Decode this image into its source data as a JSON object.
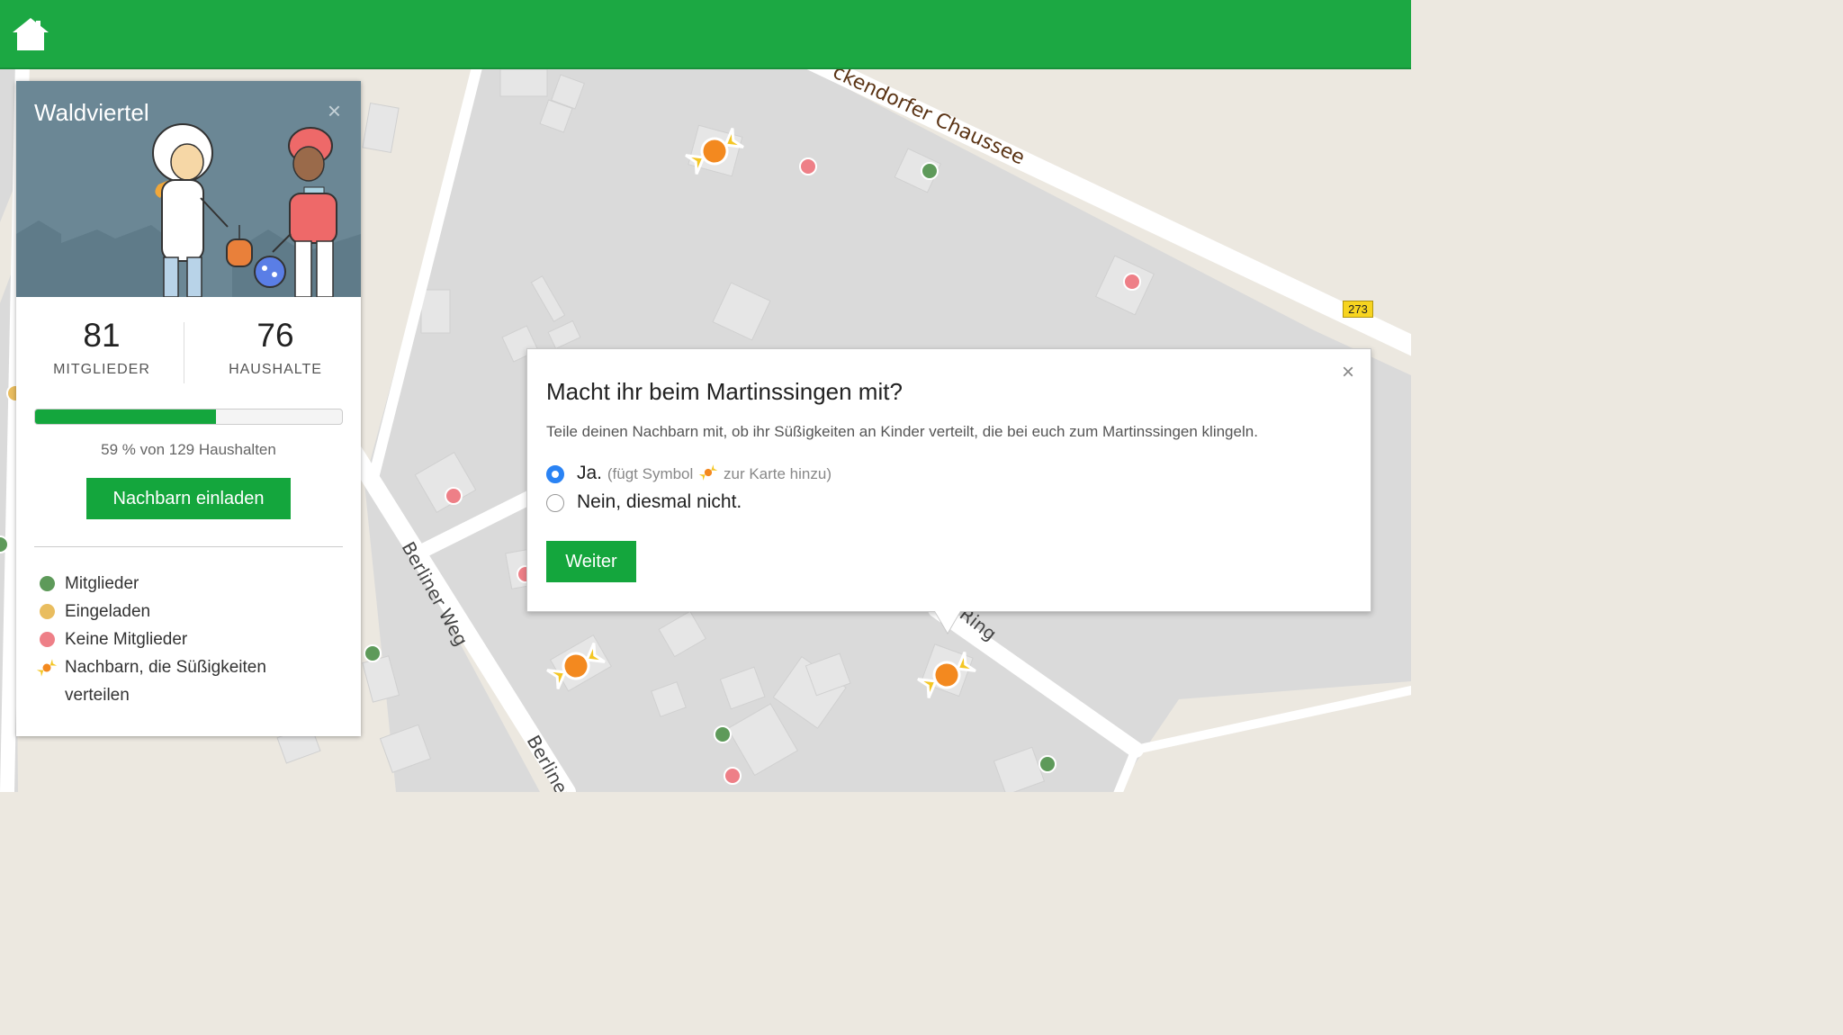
{
  "header": {
    "home_icon": "home-icon",
    "color": "#1ca843"
  },
  "map": {
    "streets": {
      "chaussee": "ckendorfer Chaussee",
      "berliner_weg": "Berliner Weg",
      "berliner_lower": "Berliner",
      "ring": "Ring"
    },
    "route_badge": "273"
  },
  "panel": {
    "title": "Waldviertel",
    "close_label": "×",
    "stats": [
      {
        "value": "81",
        "label": "MITGLIEDER"
      },
      {
        "value": "76",
        "label": "HAUSHALTE"
      }
    ],
    "progress": {
      "fraction": 0.59,
      "text": "59 % von 129 Haushalten"
    },
    "invite_button": "Nachbarn einladen",
    "legend": [
      {
        "label": "Mitglieder",
        "color": "#5e9a5a"
      },
      {
        "label": "Eingeladen",
        "color": "#e9bd5f"
      },
      {
        "label": "Keine Mitglieder",
        "color": "#ee7f87"
      },
      {
        "label": "Nachbarn, die Süßigkeiten",
        "label2": "verteilen",
        "icon": "candy-icon"
      }
    ]
  },
  "dialog": {
    "title": "Macht ihr beim Martinssingen mit?",
    "description": "Teile deinen Nachbarn mit, ob ihr Süßigkeiten an Kinder verteilt, die bei euch zum Martinssingen klingeln.",
    "close_label": "×",
    "options": [
      {
        "label": "Ja.",
        "hint_pre": "(fügt Symbol",
        "hint_post": "zur Karte hinzu)",
        "selected": true
      },
      {
        "label": "Nein, diesmal nicht.",
        "selected": false
      }
    ],
    "continue_button": "Weiter"
  }
}
